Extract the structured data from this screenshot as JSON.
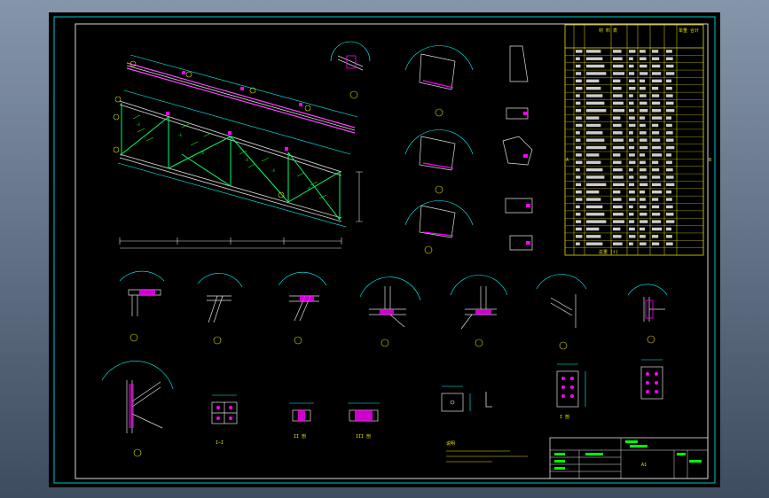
{
  "colors": {
    "desktop_top": "#8595aa",
    "desktop_bottom": "#3e4c60",
    "canvas": "#000000",
    "frame": "#d8d8d8",
    "truss": "#00ff00",
    "dimension": "#00ffff",
    "weld": "#ff00ff",
    "annotation": "#ffff00",
    "table_text": "#ffffff"
  },
  "drawing": {
    "section_labels": [
      "I—I",
      "II 剖",
      "III 剖",
      "I 剖"
    ],
    "notes_title": "说明",
    "table_title": "材 料 表",
    "table_note": "单重 合计",
    "table_side_left": "A",
    "table_side_right": "B",
    "table_last_row": "总重 (t)",
    "title_block_label": "A1"
  }
}
